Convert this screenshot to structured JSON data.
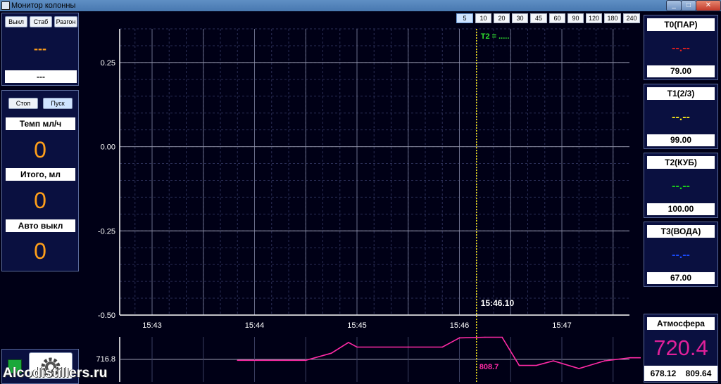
{
  "window": {
    "title": "Монитор колонны",
    "min": "_",
    "max": "□",
    "close": "✕"
  },
  "left": {
    "mode_buttons": [
      "Выкл",
      "Стаб",
      "Разгон"
    ],
    "mode_display": "---",
    "mode_value": "---",
    "controls": {
      "stop": "Стоп",
      "start": "Пуск"
    },
    "rate_label": "Темп мл/ч",
    "rate_value": "0",
    "total_label": "Итого, мл",
    "total_value": "0",
    "auto_label": "Авто выкл",
    "auto_value": "0",
    "status_color": "#1aa83a",
    "settings_icon": "gear-icon"
  },
  "scale_buttons": [
    "5",
    "10",
    "20",
    "30",
    "45",
    "60",
    "90",
    "120",
    "180",
    "240"
  ],
  "scale_selected": "5",
  "chart": {
    "y_ticks": [
      "0.25",
      "0.00",
      "-0.25",
      "-0.50"
    ],
    "x_ticks": [
      "15:43",
      "15:44",
      "15:45",
      "15:46",
      "15:47"
    ],
    "cursor_label": "T2 = .....",
    "cursor_time": "15:46.10",
    "pressure_label": "716.8",
    "cursor_pressure": "808.7"
  },
  "chart_data": {
    "type": "line",
    "title": "",
    "xlabel": "",
    "ylabel": "",
    "ylim": [
      -0.5,
      0.35
    ],
    "x_tick_labels": [
      "15:43",
      "15:44",
      "15:45",
      "15:46",
      "15:47"
    ],
    "cursor": {
      "time": "15:46.10",
      "label": "T2 = ....."
    },
    "series": [
      {
        "name": "",
        "color": "#ff2aa6",
        "x": [
          "15:43:50",
          "15:44:30",
          "15:44:45",
          "15:44:55",
          "15:45:00",
          "15:45:30",
          "15:45:50",
          "15:46:00",
          "15:46:15",
          "15:46:25",
          "15:46:35",
          "15:46:45",
          "15:46:55",
          "15:47:10",
          "15:47:25",
          "15:47:40",
          "15:47:50"
        ],
        "y": [
          716.8,
          716.8,
          740,
          775,
          760,
          760,
          760,
          790,
          792,
          792,
          700,
          700,
          715,
          690,
          715,
          725,
          725
        ]
      }
    ]
  },
  "right": {
    "sensors": [
      {
        "name": "T0(ПАР)",
        "dash": "--.--",
        "value": "79.00",
        "color": "#e02020"
      },
      {
        "name": "T1(2/3)",
        "dash": "--.--",
        "value": "99.00",
        "color": "#f2e21a"
      },
      {
        "name": "T2(КУБ)",
        "dash": "--.--",
        "value": "100.00",
        "color": "#1bd11b"
      },
      {
        "name": "T3(ВОДА)",
        "dash": "--.--",
        "value": "67.00",
        "color": "#1a4bff"
      }
    ],
    "atm_label": "Атмосфера",
    "atm_value": "720.4",
    "atm_min": "678.12",
    "atm_max": "809.64",
    "atm_color": "#e0209a"
  },
  "watermark": "Alcodistillers.ru"
}
